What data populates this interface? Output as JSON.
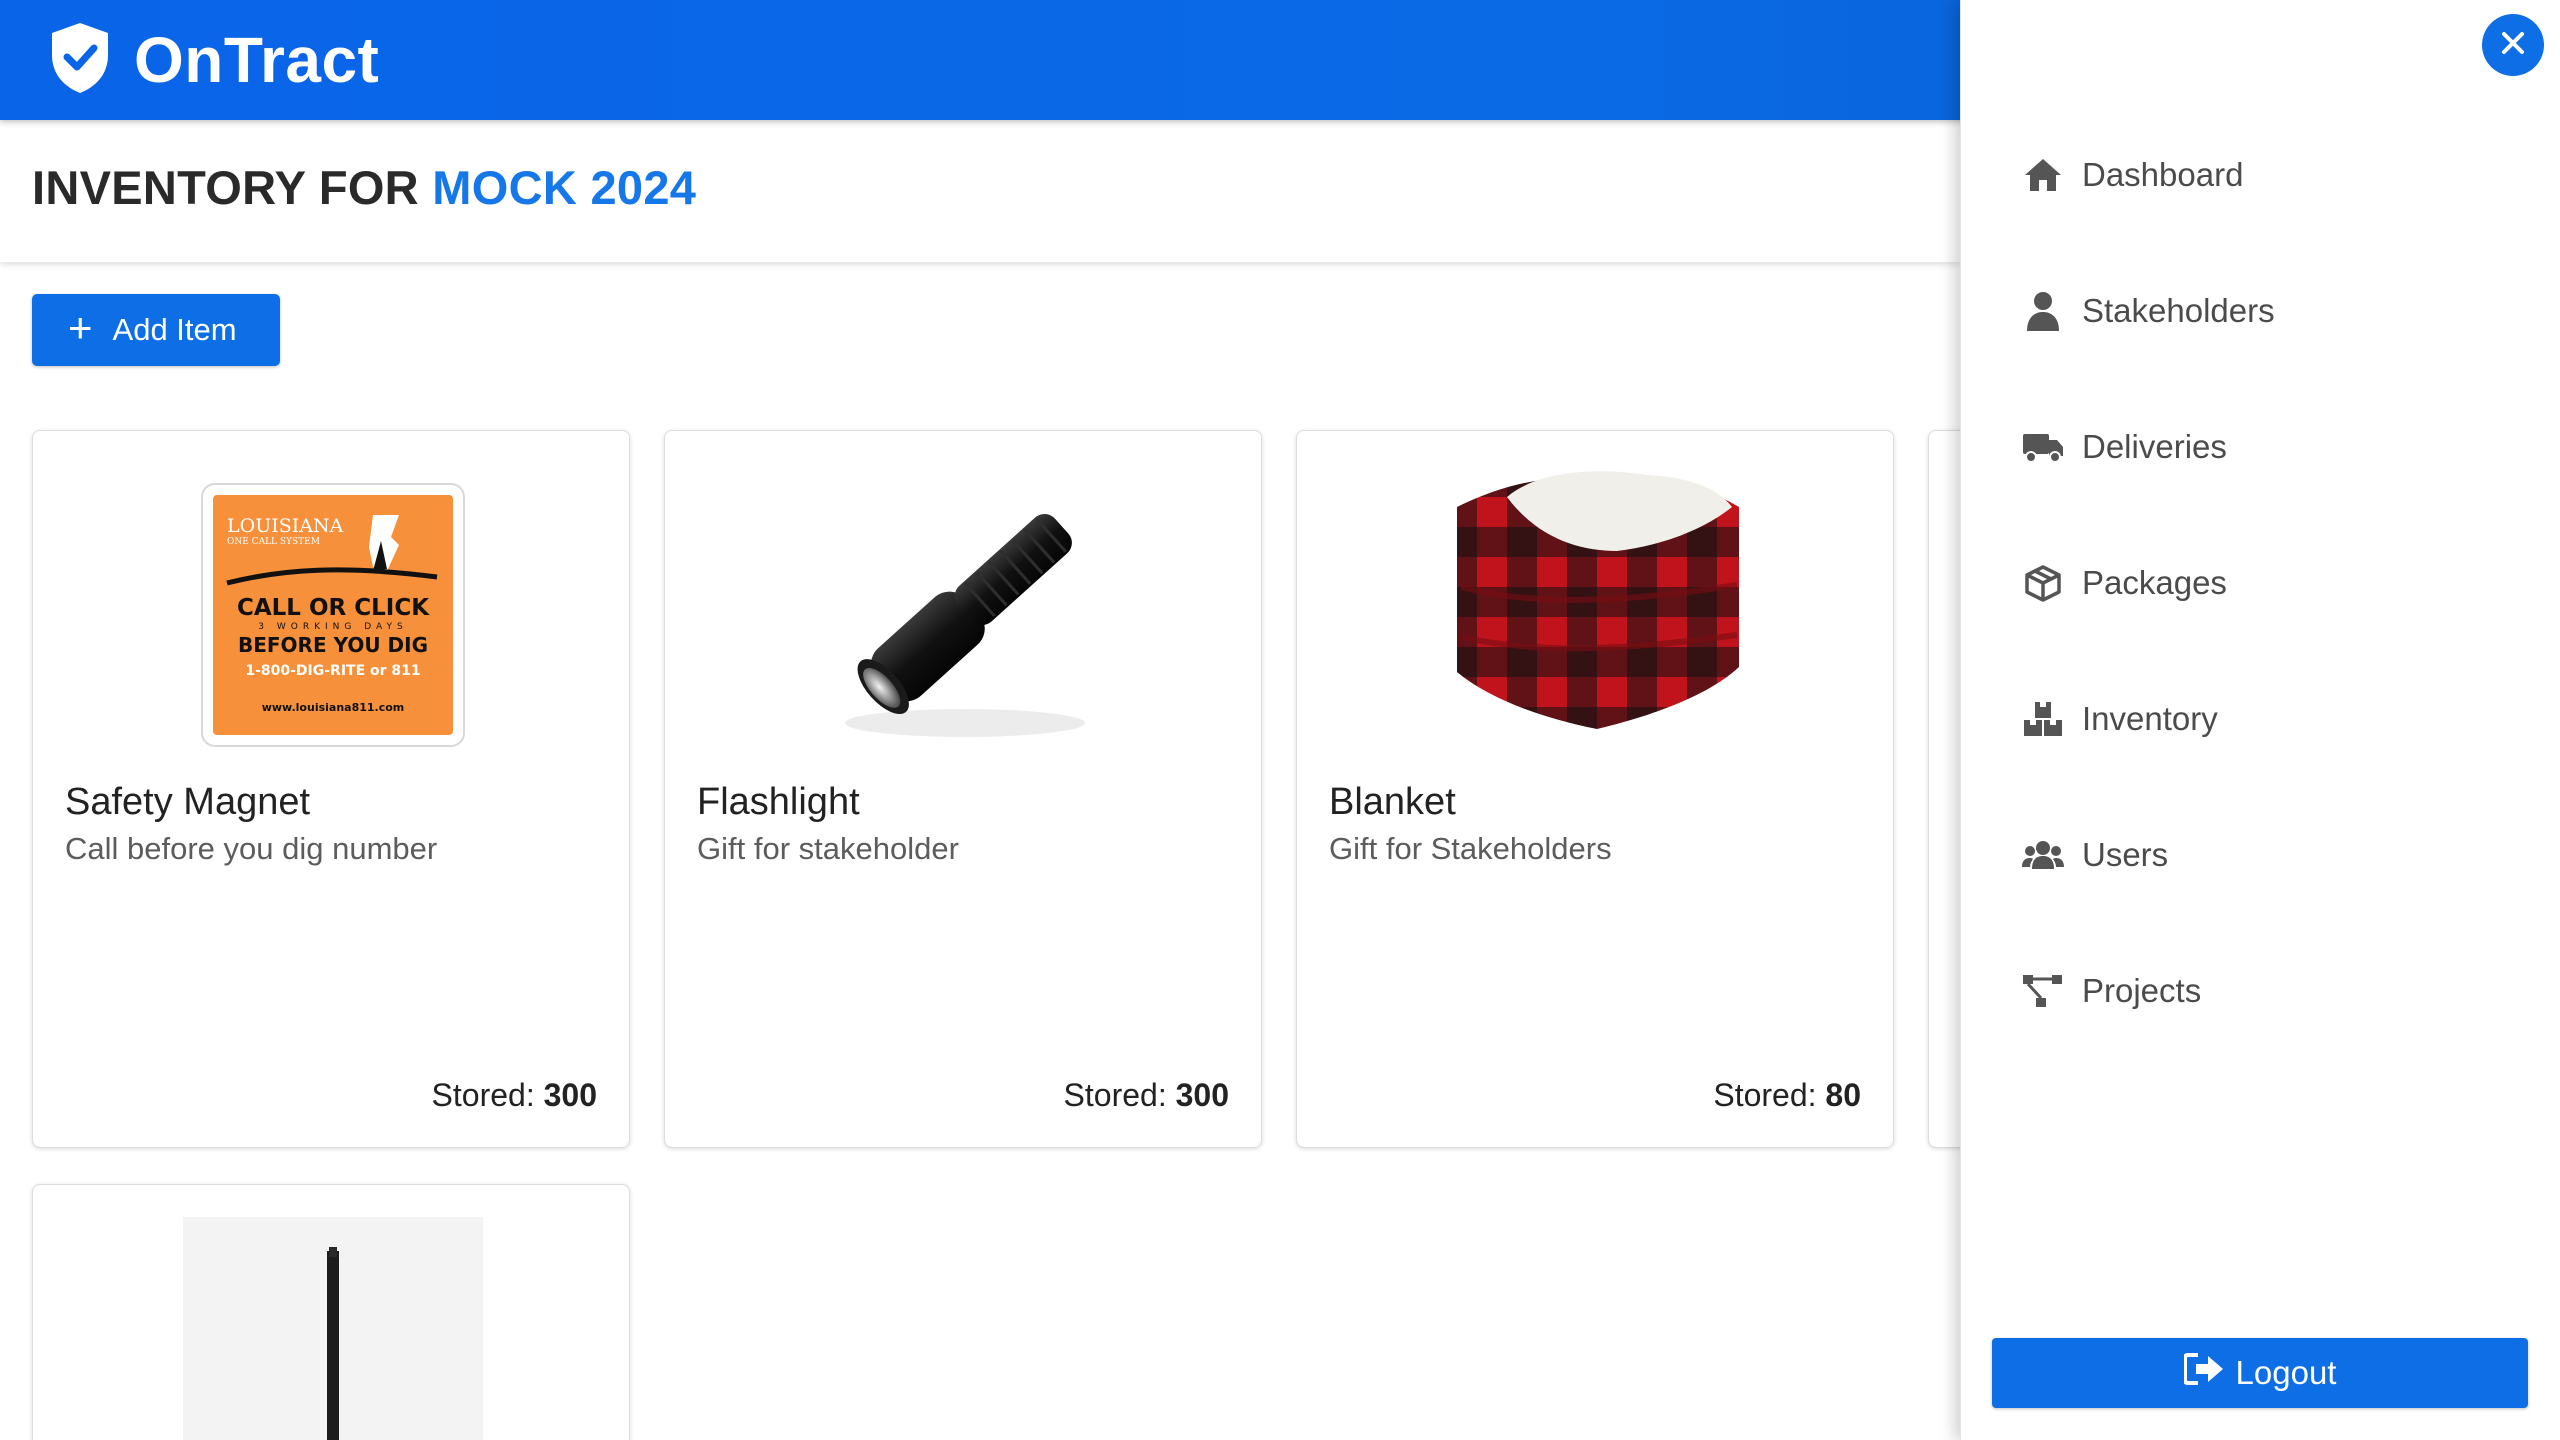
{
  "app": {
    "name": "OnTract"
  },
  "header": {
    "title_prefix": "INVENTORY FOR",
    "title_highlight": "MOCK 2024"
  },
  "toolbar": {
    "add_label": "Add Item"
  },
  "items": [
    {
      "name": "Safety Magnet",
      "description": "Call before you dig number",
      "stored_label": "Stored:",
      "stored_value": "300",
      "magnet": {
        "brand": "LOUISIANA",
        "subtitle": "ONE CALL SYSTEM",
        "line1": "CALL OR CLICK",
        "line2": "3 WORKING DAYS",
        "line3": "BEFORE YOU DIG",
        "phone": "1-800-DIG-RITE or 811",
        "url": "www.louisiana811.com"
      }
    },
    {
      "name": "Flashlight",
      "description": "Gift for stakeholder",
      "stored_label": "Stored:",
      "stored_value": "300"
    },
    {
      "name": "Blanket",
      "description": "Gift for Stakeholders",
      "stored_label": "Stored:",
      "stored_value": "80"
    }
  ],
  "drawer": {
    "nav": [
      {
        "label": "Dashboard",
        "icon": "home-icon"
      },
      {
        "label": "Stakeholders",
        "icon": "user-icon"
      },
      {
        "label": "Deliveries",
        "icon": "truck-icon"
      },
      {
        "label": "Packages",
        "icon": "box-icon"
      },
      {
        "label": "Inventory",
        "icon": "boxes-icon"
      },
      {
        "label": "Users",
        "icon": "users-icon"
      },
      {
        "label": "Projects",
        "icon": "project-diagram-icon"
      }
    ],
    "logout_label": "Logout"
  },
  "colors": {
    "primary": "#0d6ee6",
    "highlight": "#1677e8",
    "magnet_orange": "#f7903a",
    "icon_gray": "#555555"
  }
}
